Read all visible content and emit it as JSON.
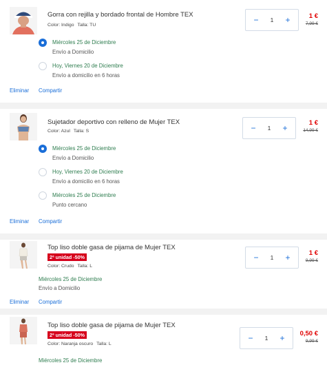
{
  "items": [
    {
      "title": "Gorra con rejilla y bordado frontal de Hombre TEX",
      "color_label": "Color: Indigo",
      "size_label": "Talla: TU",
      "quantity": "1",
      "price": "1 €",
      "old_price": "7,99 €",
      "delivery_options": [
        {
          "title": "Miércoles 25 de Diciembre",
          "subtitle": "Envío a Domicilio",
          "selected": true
        },
        {
          "title": "Hoy, Viernes 20 de Diciembre",
          "subtitle": "Envío a domicilio en 6 horas",
          "selected": false
        }
      ],
      "remove_label": "Eliminar",
      "share_label": "Compartir"
    },
    {
      "title": "Sujetador deportivo con relleno de Mujer TEX",
      "color_label": "Color: Azul",
      "size_label": "Talla: S",
      "quantity": "1",
      "price": "1 €",
      "old_price": "14,99 €",
      "delivery_options": [
        {
          "title": "Miércoles 25 de Diciembre",
          "subtitle": "Envío a Domicilio",
          "selected": true
        },
        {
          "title": "Hoy, Viernes 20 de Diciembre",
          "subtitle": "Envío a domicilio en 6 horas",
          "selected": false
        },
        {
          "title": "Miércoles 25 de Diciembre",
          "subtitle": "Punto cercano",
          "selected": false
        }
      ],
      "remove_label": "Eliminar",
      "share_label": "Compartir"
    },
    {
      "title": "Top liso doble gasa de pijama de Mujer TEX",
      "promo": "2ª unidad -50%",
      "color_label": "Color: Crudo",
      "size_label": "Talla: L",
      "quantity": "1",
      "price": "1 €",
      "old_price": "9,99 €",
      "delivery": {
        "title": "Miércoles 25 de Diciembre",
        "subtitle": "Envío a Domicilio"
      },
      "remove_label": "Eliminar",
      "share_label": "Compartir"
    },
    {
      "title": "Top liso doble gasa de pijama de Mujer TEX",
      "promo": "2ª unidad -50%",
      "color_label": "Color: Naranja oscuro",
      "size_label": "Talla: L",
      "quantity": "1",
      "price": "0,50 €",
      "old_price": "9,99 €",
      "delivery": {
        "title": "Miércoles 25 de Diciembre"
      }
    }
  ],
  "quantity_controls": {
    "minus_symbol": "−",
    "plus_symbol": "+"
  },
  "colors": {
    "accent": "#1a6ed8",
    "price": "#e00000",
    "delivery_green": "#2e7d4f",
    "promo_badge": "#d6001c"
  },
  "thumbnails": [
    "product-photo-cap",
    "product-photo-sports-bra",
    "product-photo-pajama-top-cream",
    "product-photo-pajama-top-orange"
  ]
}
